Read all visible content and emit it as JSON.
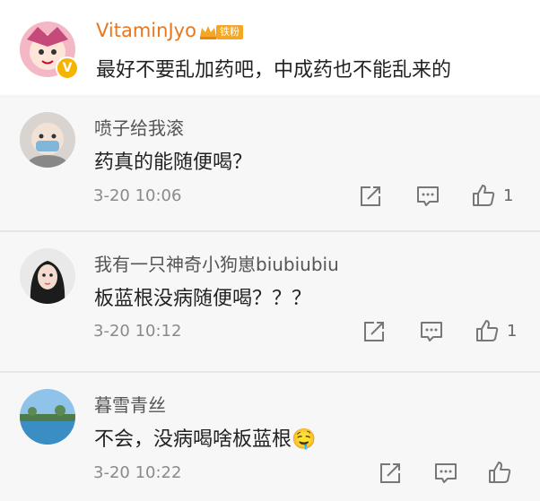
{
  "comments": [
    {
      "user": "VitaminJyo",
      "badge": "铁粉",
      "text": "最好不要乱加药吧，中成药也不能乱来的"
    },
    {
      "user": "喷子给我滚",
      "text": "药真的能随便喝？",
      "time": "3-20 10:06",
      "likes": "1"
    },
    {
      "user": "我有一只神奇小狗崽biubiubiu",
      "text": "板蓝根没病随便喝？？？",
      "time": "3-20 10:12",
      "likes": "1"
    },
    {
      "user": "暮雪青丝",
      "text": "不会，没病喝啥板蓝根",
      "emoji": "🤤",
      "time": "3-20 10:22",
      "likes": ""
    }
  ],
  "icons": {
    "share": "share-icon",
    "comment": "comment-icon",
    "like": "like-icon",
    "vip": "verified-v-icon",
    "crown": "crown-icon"
  },
  "colors": {
    "vip_name": "#e8771f",
    "badge_bg": "#f5a623",
    "verified": "#f5b400"
  }
}
